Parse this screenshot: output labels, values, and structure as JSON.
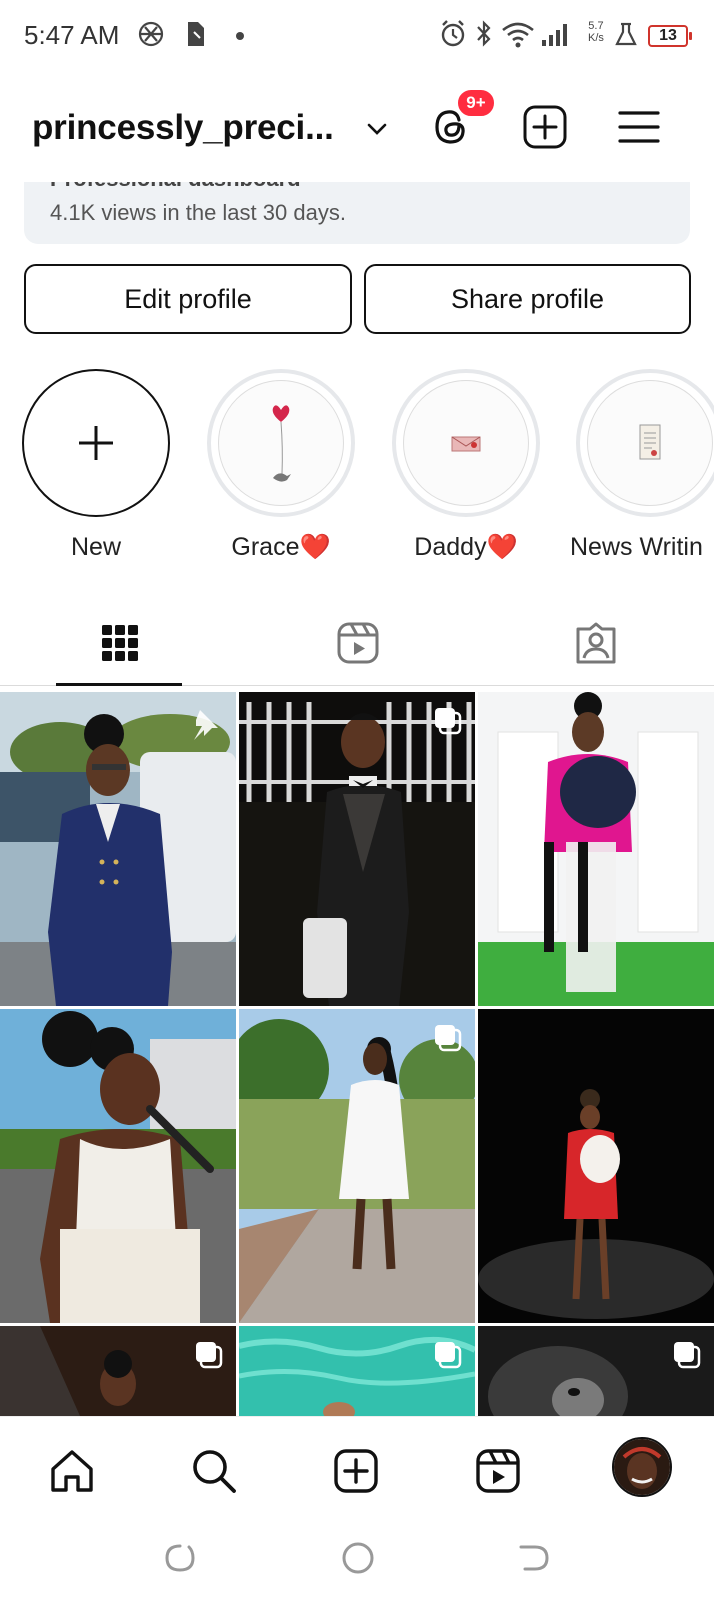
{
  "status_bar": {
    "time": "5:47 AM",
    "speed_value": "5.7",
    "speed_unit": "K/s",
    "battery": "13",
    "icons": [
      "openai-icon",
      "sim-icon",
      "alarm-icon",
      "bluetooth-icon",
      "wifi-icon",
      "signal-icon",
      "flask-icon",
      "battery-icon"
    ]
  },
  "header": {
    "username": "princessly_preci...",
    "notification_badge": "9+",
    "icons": [
      "chevron-down-icon",
      "threads-icon",
      "new-post-icon",
      "menu-icon"
    ]
  },
  "dashboard": {
    "title_clipped": "Professional dashboard",
    "views_text": "4.1K views in the last 30 days."
  },
  "profile_actions": {
    "edit_label": "Edit profile",
    "share_label": "Share profile"
  },
  "highlights": [
    {
      "label": "New",
      "type": "new"
    },
    {
      "label": "Grace❤️",
      "type": "story"
    },
    {
      "label": "Daddy❤️",
      "type": "story"
    },
    {
      "label": "News Writin",
      "type": "story"
    }
  ],
  "tabs": [
    {
      "name": "grid",
      "icon": "grid-icon",
      "active": true
    },
    {
      "name": "reels",
      "icon": "reels-icon",
      "active": false
    },
    {
      "name": "tagged",
      "icon": "tagged-icon",
      "active": false
    }
  ],
  "posts": [
    {
      "subject": "person in navy suit",
      "pinned": true,
      "multi": false
    },
    {
      "subject": "person in dark suit with bow tie",
      "pinned": false,
      "multi": true
    },
    {
      "subject": "person in pink blazer with hat",
      "pinned": false,
      "multi": false
    },
    {
      "subject": "person with microphone",
      "pinned": false,
      "multi": false
    },
    {
      "subject": "person in white dress",
      "pinned": false,
      "multi": true
    },
    {
      "subject": "person in red dress",
      "pinned": false,
      "multi": false
    },
    {
      "subject": "portrait",
      "pinned": false,
      "multi": true
    },
    {
      "subject": "pool",
      "pinned": false,
      "multi": true
    },
    {
      "subject": "black and white portrait",
      "pinned": false,
      "multi": true
    }
  ],
  "bottom_nav": [
    "home-icon",
    "search-icon",
    "create-icon",
    "reels-icon",
    "profile-avatar"
  ],
  "system_nav": [
    "recents-icon",
    "home-circle-icon",
    "back-icon"
  ],
  "colors": {
    "badge": "#ff2d40",
    "battery_warning": "#d0342c",
    "dashboard_bg": "#eff2f5"
  }
}
